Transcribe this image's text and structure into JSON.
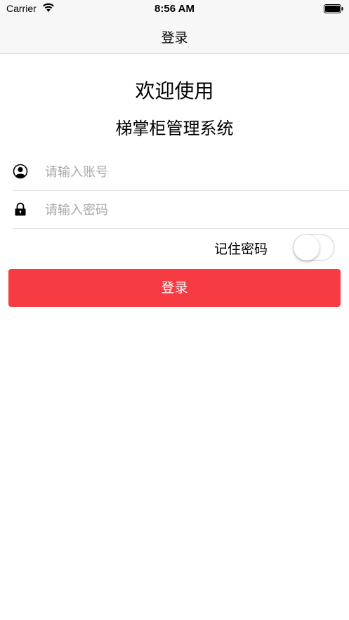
{
  "status_bar": {
    "carrier": "Carrier",
    "time": "8:56 AM",
    "icons": [
      "wifi-icon",
      "battery-icon"
    ]
  },
  "nav": {
    "title": "登录"
  },
  "welcome": {
    "title": "欢迎使用",
    "subtitle": "梯掌柜管理系统"
  },
  "form": {
    "account": {
      "icon": "user-icon",
      "value": "",
      "placeholder": "请输入账号"
    },
    "password": {
      "icon": "lock-icon",
      "value": "",
      "placeholder": "请输入密码"
    },
    "remember": {
      "label": "记住密码",
      "on": false
    },
    "login_label": "登录"
  },
  "colors": {
    "accent": "#f63c42",
    "bar_background": "#f7f7f7",
    "placeholder": "#a8a8a8"
  }
}
